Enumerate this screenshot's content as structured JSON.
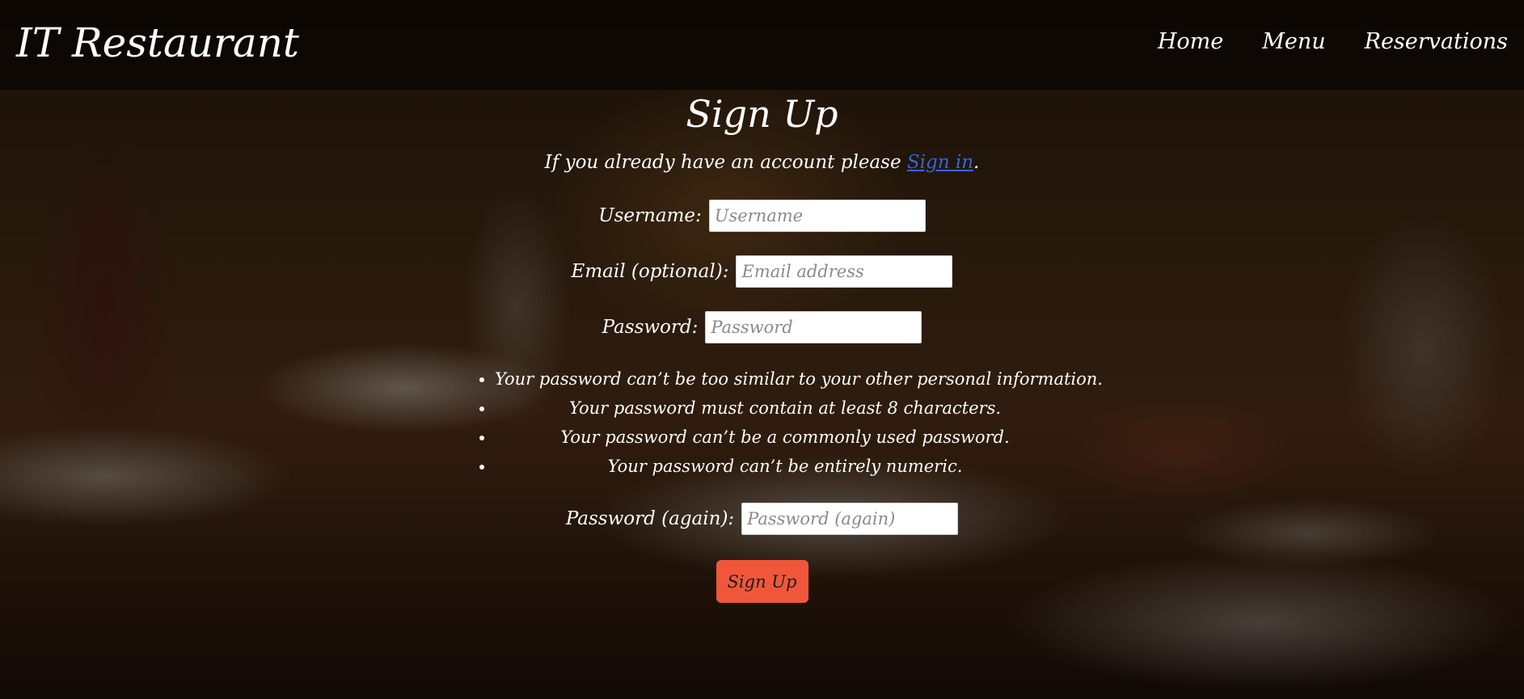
{
  "navbar": {
    "brand": "IT Restaurant",
    "links": [
      {
        "label": "Home"
      },
      {
        "label": "Menu"
      },
      {
        "label": "Reservations"
      }
    ]
  },
  "page": {
    "title": "Sign Up",
    "intro_prefix": "If you already have an account please ",
    "intro_link": "Sign in",
    "intro_suffix": "."
  },
  "form": {
    "username": {
      "label": "Username:",
      "placeholder": "Username",
      "value": ""
    },
    "email": {
      "label": "Email (optional):",
      "placeholder": "Email address",
      "value": ""
    },
    "password": {
      "label": "Password:",
      "placeholder": "Password",
      "value": ""
    },
    "password_rules": [
      "Your password can’t be too similar to your other personal information.",
      "Your password must contain at least 8 characters.",
      "Your password can’t be a commonly used password.",
      "Your password can’t be entirely numeric."
    ],
    "password_again": {
      "label": "Password (again):",
      "placeholder": "Password (again)",
      "value": ""
    },
    "submit_label": "Sign Up"
  },
  "colors": {
    "submit_button": "#f0573a",
    "link": "#3a63d8",
    "navbar_overlay": "rgba(0,0,0,0.55)",
    "text": "#ffffff"
  }
}
